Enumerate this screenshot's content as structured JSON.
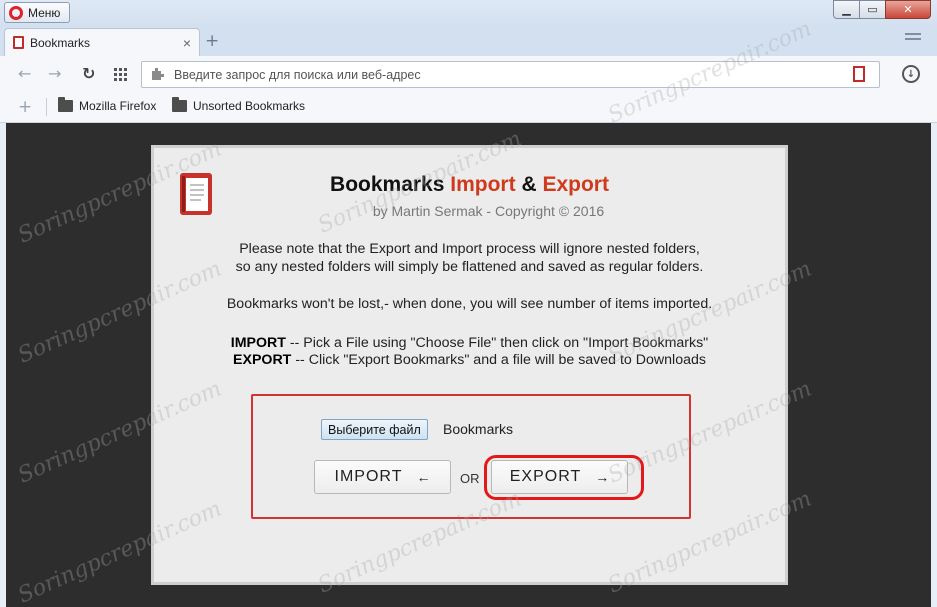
{
  "window": {
    "menu_label": "Меню",
    "controls": [
      "minimize",
      "maximize",
      "close"
    ]
  },
  "tab": {
    "title": "Bookmarks"
  },
  "address_bar": {
    "placeholder": "Введите запрос для поиска или веб-адрес",
    "value": ""
  },
  "bookmarks_bar": {
    "items": [
      {
        "label": "Mozilla Firefox"
      },
      {
        "label": "Unsorted Bookmarks"
      }
    ]
  },
  "page": {
    "title_part1": "Bookmarks",
    "title_import": "Import",
    "title_amp": "&",
    "title_export": "Export",
    "subtitle": "by Martin Sermak - Copyright © 2016",
    "note_line1": "Please note that the Export and Import process will ignore nested folders,",
    "note_line2": "so any nested folders will simply be flattened and saved as regular folders.",
    "note_line3": "Bookmarks won't be lost,- when done, you will see number of items imported.",
    "import_label": "IMPORT",
    "import_text": "-- Pick a File using \"Choose File\" then click on \"Import Bookmarks\"",
    "export_label": "EXPORT",
    "export_text": "-- Click \"Export Bookmarks\" and a file will be saved to Downloads",
    "choose_file_label": "Выберите файл",
    "chosen_file": "Bookmarks",
    "import_button": "IMPORT",
    "import_arrow": "←",
    "or_label": "OR",
    "export_button": "EXPORT",
    "export_arrow": "→"
  },
  "watermark": "Soringpcrepair.com",
  "colors": {
    "accent_red": "#d03a1c",
    "highlight_red": "#e41818",
    "viewport_bg": "#2d2d2d"
  }
}
